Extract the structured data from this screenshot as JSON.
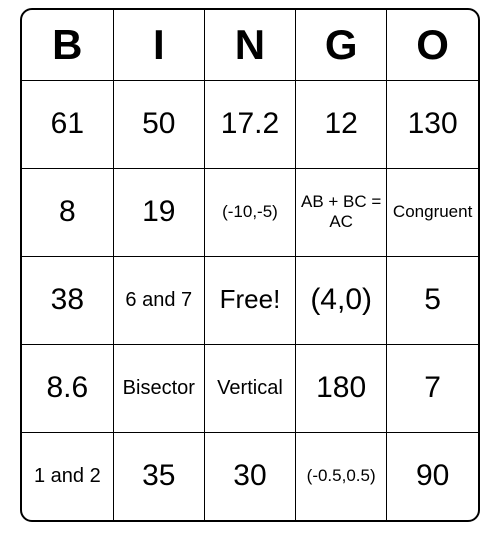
{
  "headers": [
    "B",
    "I",
    "N",
    "G",
    "O"
  ],
  "grid": [
    [
      {
        "v": "61",
        "size": "lg"
      },
      {
        "v": "50",
        "size": "lg"
      },
      {
        "v": "17.2",
        "size": "lg"
      },
      {
        "v": "12",
        "size": "lg"
      },
      {
        "v": "130",
        "size": "lg"
      }
    ],
    [
      {
        "v": "8",
        "size": "lg"
      },
      {
        "v": "19",
        "size": "lg"
      },
      {
        "v": "(-10,-5)",
        "size": "sm"
      },
      {
        "v": "AB + BC = AC",
        "size": "sm"
      },
      {
        "v": "Congruent",
        "size": "sm"
      }
    ],
    [
      {
        "v": "38",
        "size": "lg"
      },
      {
        "v": "6 and 7",
        "size": "md"
      },
      {
        "v": "Free!",
        "size": "free"
      },
      {
        "v": "(4,0)",
        "size": "lg"
      },
      {
        "v": "5",
        "size": "lg"
      }
    ],
    [
      {
        "v": "8.6",
        "size": "lg"
      },
      {
        "v": "Bisector",
        "size": "md"
      },
      {
        "v": "Vertical",
        "size": "md"
      },
      {
        "v": "180",
        "size": "lg"
      },
      {
        "v": "7",
        "size": "lg"
      }
    ],
    [
      {
        "v": "1 and 2",
        "size": "md"
      },
      {
        "v": "35",
        "size": "lg"
      },
      {
        "v": "30",
        "size": "lg"
      },
      {
        "v": "(-0.5,0.5)",
        "size": "sm"
      },
      {
        "v": "90",
        "size": "lg"
      }
    ]
  ]
}
